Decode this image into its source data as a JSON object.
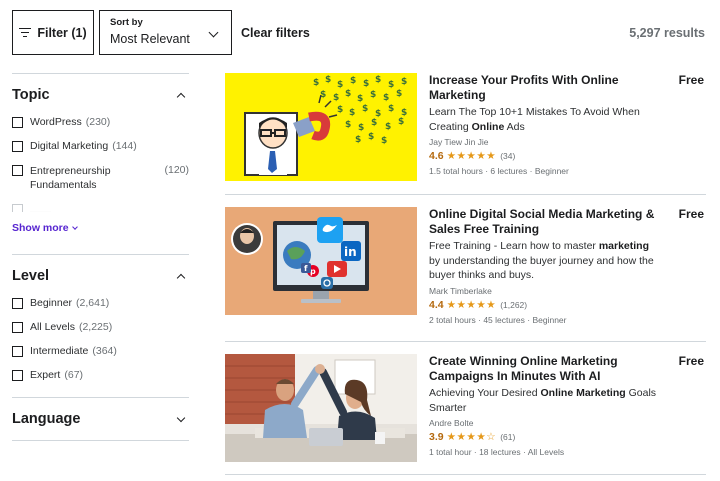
{
  "toolbar": {
    "filter_label": "Filter (1)",
    "sort_label": "Sort by",
    "sort_value": "Most Relevant",
    "clear_filters": "Clear filters",
    "results_count": "5,297 results"
  },
  "sidebar": {
    "topic": {
      "title": "Topic",
      "items": [
        {
          "name": "WordPress",
          "count": "(230)"
        },
        {
          "name": "Digital Marketing",
          "count": "(144)"
        },
        {
          "name": "Entrepreneurship Fundamentals",
          "count": "(120)"
        }
      ],
      "show_more": "Show more"
    },
    "level": {
      "title": "Level",
      "items": [
        {
          "name": "Beginner",
          "count": "(2,641)"
        },
        {
          "name": "All Levels",
          "count": "(2,225)"
        },
        {
          "name": "Intermediate",
          "count": "(364)"
        },
        {
          "name": "Expert",
          "count": "(67)"
        }
      ]
    },
    "language": {
      "title": "Language"
    }
  },
  "courses": [
    {
      "title": "Increase Your Profits With Online Marketing",
      "desc_pre": "Learn The Top 10+1 Mistakes To Avoid When Creating ",
      "desc_bold": "Online",
      "desc_post": " Ads",
      "author": "Jay Tiew Jin Jie",
      "rating": "4.6",
      "stars": "★★★★★",
      "rating_count": "(34)",
      "meta": "1.5 total hours · 6 lectures · Beginner",
      "price": "Free"
    },
    {
      "title": "Online Digital Social Media Marketing & Sales Free Training",
      "desc_pre": "Free Training - Learn how to master ",
      "desc_bold": "marketing",
      "desc_post": " by understanding the buyer journey and how the buyer thinks and buys.",
      "author": "Mark Timberlake",
      "rating": "4.4",
      "stars": "★★★★★",
      "rating_count": "(1,262)",
      "meta": "2 total hours · 45 lectures · Beginner",
      "price": "Free"
    },
    {
      "title": "Create Winning Online Marketing Campaigns In Minutes With AI",
      "desc_pre": "Achieving Your Desired ",
      "desc_bold": "Online Marketing",
      "desc_post": " Goals Smarter",
      "author": "Andre Bolte",
      "rating": "3.9",
      "stars": "★★★★☆",
      "rating_count": "(61)",
      "meta": "1 total hour · 18 lectures · All Levels",
      "price": "Free"
    }
  ],
  "colors": {
    "accent": "#5624d0",
    "rating": "#b4690e",
    "star": "#e59819",
    "thumb1_bg": "#fff200",
    "thumb2_bg": "#e8a877"
  }
}
